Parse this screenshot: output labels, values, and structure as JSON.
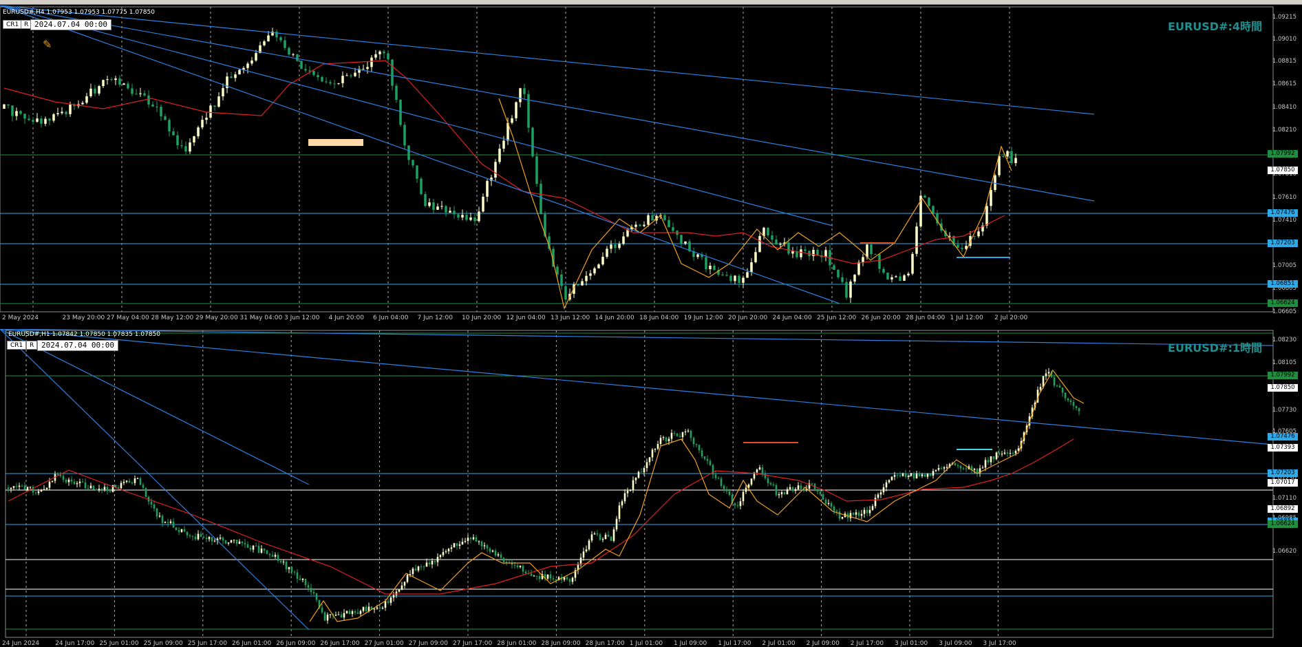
{
  "top_chart": {
    "header": "EURUSD#,H4  1.07953 1.07953 1.07775 1.07850",
    "cr_label": "CR1",
    "r_label": "R",
    "date_value": "2024.07.04  00:00",
    "tf_title": "EURUSD#:4時間",
    "y_ticks": [
      "1.09215",
      "1.09010",
      "1.08815",
      "1.08615",
      "1.08410",
      "1.08210",
      "1.07810",
      "1.07610",
      "1.07410",
      "1.07005",
      "1.06805",
      "1.06605"
    ],
    "price_labels": [
      {
        "text": "1.07992",
        "bg": "#1f8f3f",
        "fg": "#000000"
      },
      {
        "text": "1.07850",
        "bg": "#ffffff",
        "fg": "#000000"
      },
      {
        "text": "1.07476",
        "bg": "#2fa8e8",
        "fg": "#000000"
      },
      {
        "text": "1.07203",
        "bg": "#2fa8e8",
        "fg": "#000000"
      },
      {
        "text": "1.06851",
        "bg": "#2fa8e8",
        "fg": "#000000"
      },
      {
        "text": "1.06624",
        "bg": "#1f8f3f",
        "fg": "#000000"
      }
    ],
    "x_ticks": [
      "2 May 2024",
      "23 May 20:00",
      "27 May 04:00",
      "28 May 12:00",
      "29 May 20:00",
      "31 May 04:00",
      "3 Jun 12:00",
      "4 Jun 20:00",
      "6 Jun 04:00",
      "7 Jun 12:00",
      "10 Jun 20:00",
      "12 Jun 04:00",
      "13 Jun 12:00",
      "14 Jun 20:00",
      "18 Jun 04:00",
      "19 Jun 12:00",
      "20 Jun 20:00",
      "24 Jun 04:00",
      "25 Jun 12:00",
      "26 Jun 20:00",
      "28 Jun 04:00",
      "1 Jul 12:00",
      "2 Jul 20:00"
    ]
  },
  "bottom_chart": {
    "header": "EURUSD#,H1  1.07842 1.07850 1.07835 1.07850",
    "cr_label": "CR1",
    "r_label": "R",
    "date_value": "2024.07.04  00:00",
    "tf_title": "EURUSD#:1時間",
    "y_ticks": [
      "1.08230",
      "1.08105",
      "1.07730",
      "1.07605",
      "1.07230",
      "1.07110",
      "1.06985",
      "1.06620"
    ],
    "price_labels": [
      {
        "text": "1.07992",
        "bg": "#1f8f3f",
        "fg": "#000000"
      },
      {
        "text": "1.07850",
        "bg": "#ffffff",
        "fg": "#000000"
      },
      {
        "text": "1.07476",
        "bg": "#2fa8e8",
        "fg": "#000000"
      },
      {
        "text": "1.07393",
        "bg": "#ffffff",
        "fg": "#000000"
      },
      {
        "text": "1.07203",
        "bg": "#2fa8e8",
        "fg": "#000000"
      },
      {
        "text": "1.07017",
        "bg": "#ffffff",
        "fg": "#000000"
      },
      {
        "text": "1.06892",
        "bg": "#ffffff",
        "fg": "#000000"
      },
      {
        "text": "1.06851",
        "bg": "#2fa8e8",
        "fg": "#000000"
      },
      {
        "text": "1.06624",
        "bg": "#1f8f3f",
        "fg": "#000000"
      }
    ],
    "x_ticks": [
      "24 Jun 2024",
      "24 Jun 17:00",
      "25 Jun 01:00",
      "25 Jun 09:00",
      "25 Jun 17:00",
      "26 Jun 01:00",
      "26 Jun 09:00",
      "26 Jun 17:00",
      "27 Jun 01:00",
      "27 Jun 09:00",
      "27 Jun 17:00",
      "28 Jun 01:00",
      "28 Jun 09:00",
      "28 Jun 17:00",
      "1 Jul 01:00",
      "1 Jul 09:00",
      "1 Jul 17:00",
      "2 Jul 01:00",
      "2 Jul 09:00",
      "2 Jul 17:00",
      "3 Jul 01:00",
      "3 Jul 09:00",
      "3 Jul 17:00"
    ]
  },
  "colors": {
    "background": "#000000",
    "bull_candle": "#ffffcc",
    "bear_candle": "#1fa060",
    "ma_line": "#e02020",
    "zigzag": "#f0a020",
    "trendline": "#2f7fe0",
    "hline_blue": "#2fa8e8",
    "hline_green": "#1f8f3f"
  }
}
